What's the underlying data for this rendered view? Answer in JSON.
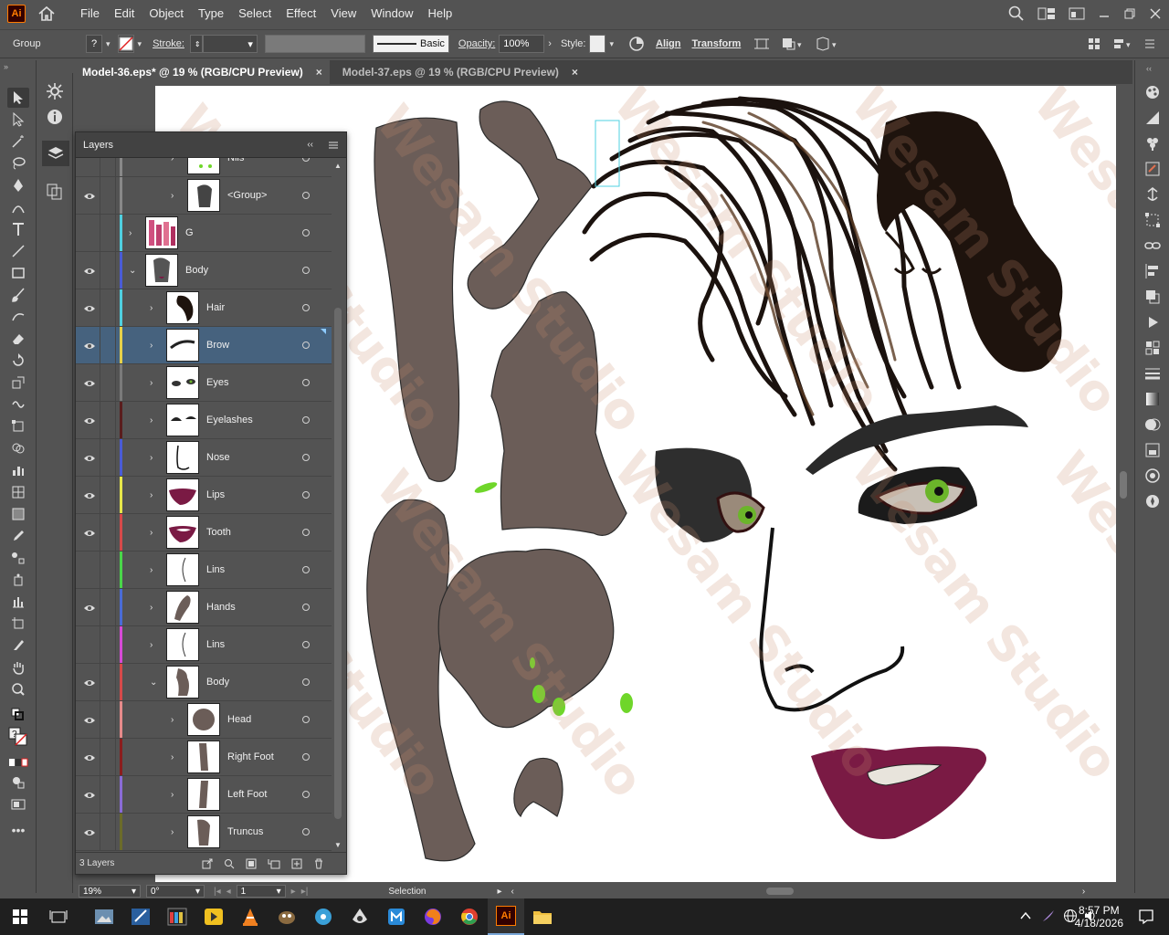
{
  "app": {
    "logo_text": "Ai",
    "menu": [
      "File",
      "Edit",
      "Object",
      "Type",
      "Select",
      "Effect",
      "View",
      "Window",
      "Help"
    ]
  },
  "control_bar": {
    "selection_type": "Group",
    "stroke_label": "Stroke:",
    "brush_label": "Basic",
    "opacity_label": "Opacity:",
    "opacity_value": "100%",
    "style_label": "Style:",
    "align_label": "Align",
    "transform_label": "Transform"
  },
  "tabs": [
    {
      "label": "Model-36.eps* @ 19 % (RGB/CPU Preview)",
      "close": "×"
    },
    {
      "label": "Model-37.eps @ 19 % (RGB/CPU Preview)",
      "close": "×"
    }
  ],
  "layers_panel": {
    "title": "Layers",
    "collapse": "‹‹",
    "rows": [
      {
        "name": "Nils",
        "visible": false,
        "color": "#888888"
      },
      {
        "name": "<Group>",
        "visible": true,
        "color": "#888888"
      },
      {
        "name": "G",
        "visible": false,
        "color": "#4fd0e0"
      },
      {
        "name": "Body",
        "visible": true,
        "color": "#4a5bd6"
      },
      {
        "name": "Hair",
        "visible": true,
        "color": "#4fd0e0"
      },
      {
        "name": "Brow",
        "visible": true,
        "color": "#e6d14a"
      },
      {
        "name": "Eyes",
        "visible": true,
        "color": "#7a7a7a"
      },
      {
        "name": "Eyelashes",
        "visible": true,
        "color": "#5a1d1d"
      },
      {
        "name": "Nose",
        "visible": true,
        "color": "#4a5bd6"
      },
      {
        "name": "Lips",
        "visible": true,
        "color": "#e6e64a"
      },
      {
        "name": "Tooth",
        "visible": true,
        "color": "#d64a4a"
      },
      {
        "name": "Lins",
        "visible": false,
        "color": "#4ad64a"
      },
      {
        "name": "Hands",
        "visible": true,
        "color": "#4a6bd6"
      },
      {
        "name": "Lins",
        "visible": false,
        "color": "#d64ad6"
      },
      {
        "name": "Body",
        "visible": true,
        "color": "#d64a4a"
      },
      {
        "name": "Head",
        "visible": true,
        "color": "#e68a8a"
      },
      {
        "name": "Right Foot",
        "visible": true,
        "color": "#8a1d1d"
      },
      {
        "name": "Left Foot",
        "visible": true,
        "color": "#8a6bd6"
      },
      {
        "name": "Truncus",
        "visible": true,
        "color": "#6b6b2a"
      }
    ],
    "footer_count": "3 Layers"
  },
  "status": {
    "zoom": "19%",
    "rotation": "0°",
    "artboard": "1",
    "tool": "Selection"
  },
  "taskbar": {
    "time": "8:57 PM",
    "date": "4/18/2026",
    "ai_label": "Ai"
  },
  "watermark_text": "Wesam Studio",
  "colors": {
    "selected_row": "#46627e",
    "skin": "#6b5d58",
    "lips": "#7a1a44",
    "eye_green": "#6bb52a",
    "accent_green": "#6fd62a"
  }
}
